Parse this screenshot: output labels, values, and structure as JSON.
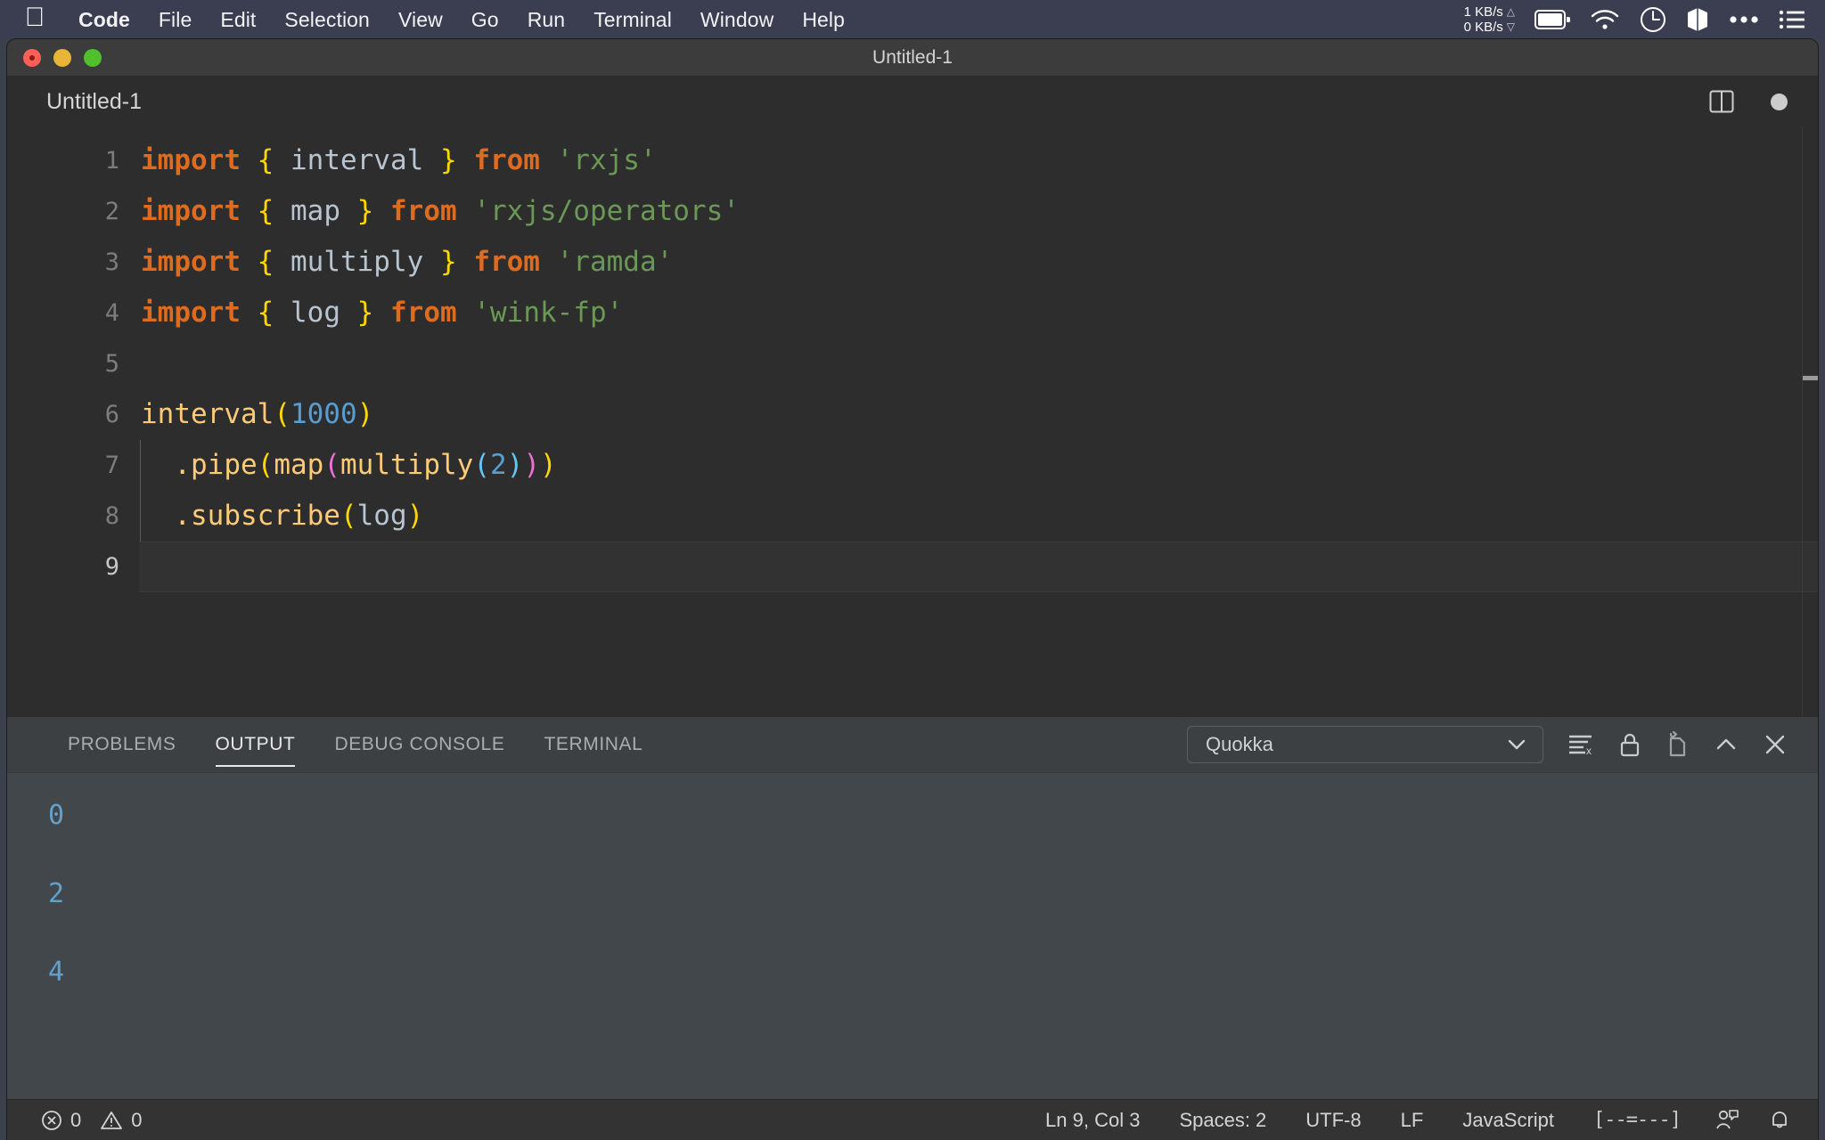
{
  "menubar": {
    "apple_icon": "apple-logo-icon",
    "items": [
      {
        "label": "Code",
        "bold": true
      },
      {
        "label": "File",
        "bold": false
      },
      {
        "label": "Edit",
        "bold": false
      },
      {
        "label": "Selection",
        "bold": false
      },
      {
        "label": "View",
        "bold": false
      },
      {
        "label": "Go",
        "bold": false
      },
      {
        "label": "Run",
        "bold": false
      },
      {
        "label": "Terminal",
        "bold": false
      },
      {
        "label": "Window",
        "bold": false
      },
      {
        "label": "Help",
        "bold": false
      }
    ],
    "network": {
      "upload": "1 KB/s",
      "download": "0 KB/s"
    },
    "status_icons": [
      "battery-icon",
      "wifi-icon",
      "clock-icon",
      "box-icon",
      "ellipsis-icon",
      "list-icon"
    ]
  },
  "window": {
    "title": "Untitled-1",
    "traffic_lights": [
      "close-button",
      "minimize-button",
      "maximize-button"
    ]
  },
  "editor": {
    "filename": "Untitled-1",
    "split_icon": "split-editor-icon",
    "dirty_indicator": "unsaved-changes-dot",
    "language": "JavaScript",
    "lines": [
      {
        "number": "1",
        "tokens": [
          {
            "t": "import",
            "c": "tk-keyword"
          },
          {
            "t": " ",
            "c": "tk-ident"
          },
          {
            "t": "{",
            "c": "tk-brace"
          },
          {
            "t": " interval ",
            "c": "tk-ident"
          },
          {
            "t": "}",
            "c": "tk-brace"
          },
          {
            "t": " ",
            "c": "tk-ident"
          },
          {
            "t": "from",
            "c": "tk-keyword"
          },
          {
            "t": " ",
            "c": "tk-ident"
          },
          {
            "t": "'rxjs'",
            "c": "tk-string"
          }
        ]
      },
      {
        "number": "2",
        "tokens": [
          {
            "t": "import",
            "c": "tk-keyword"
          },
          {
            "t": " ",
            "c": "tk-ident"
          },
          {
            "t": "{",
            "c": "tk-brace"
          },
          {
            "t": " map ",
            "c": "tk-ident"
          },
          {
            "t": "}",
            "c": "tk-brace"
          },
          {
            "t": " ",
            "c": "tk-ident"
          },
          {
            "t": "from",
            "c": "tk-keyword"
          },
          {
            "t": " ",
            "c": "tk-ident"
          },
          {
            "t": "'rxjs/operators'",
            "c": "tk-string"
          }
        ]
      },
      {
        "number": "3",
        "tokens": [
          {
            "t": "import",
            "c": "tk-keyword"
          },
          {
            "t": " ",
            "c": "tk-ident"
          },
          {
            "t": "{",
            "c": "tk-brace"
          },
          {
            "t": " multiply ",
            "c": "tk-ident"
          },
          {
            "t": "}",
            "c": "tk-brace"
          },
          {
            "t": " ",
            "c": "tk-ident"
          },
          {
            "t": "from",
            "c": "tk-keyword"
          },
          {
            "t": " ",
            "c": "tk-ident"
          },
          {
            "t": "'ramda'",
            "c": "tk-string"
          }
        ]
      },
      {
        "number": "4",
        "tokens": [
          {
            "t": "import",
            "c": "tk-keyword"
          },
          {
            "t": " ",
            "c": "tk-ident"
          },
          {
            "t": "{",
            "c": "tk-brace"
          },
          {
            "t": " log ",
            "c": "tk-ident"
          },
          {
            "t": "}",
            "c": "tk-brace"
          },
          {
            "t": " ",
            "c": "tk-ident"
          },
          {
            "t": "from",
            "c": "tk-keyword"
          },
          {
            "t": " ",
            "c": "tk-ident"
          },
          {
            "t": "'wink-fp'",
            "c": "tk-string"
          }
        ]
      },
      {
        "number": "5",
        "tokens": []
      },
      {
        "number": "6",
        "tokens": [
          {
            "t": "interval",
            "c": "tk-func"
          },
          {
            "t": "(",
            "c": "tk-paren1"
          },
          {
            "t": "1000",
            "c": "tk-num"
          },
          {
            "t": ")",
            "c": "tk-paren1"
          }
        ]
      },
      {
        "number": "7",
        "indent_guide": true,
        "tokens": [
          {
            "t": "  .pipe",
            "c": "tk-func"
          },
          {
            "t": "(",
            "c": "tk-paren1"
          },
          {
            "t": "map",
            "c": "tk-func"
          },
          {
            "t": "(",
            "c": "tk-paren2"
          },
          {
            "t": "multiply",
            "c": "tk-func"
          },
          {
            "t": "(",
            "c": "tk-paren3"
          },
          {
            "t": "2",
            "c": "tk-num"
          },
          {
            "t": ")",
            "c": "tk-paren3"
          },
          {
            "t": ")",
            "c": "tk-paren2"
          },
          {
            "t": ")",
            "c": "tk-paren1"
          }
        ]
      },
      {
        "number": "8",
        "indent_guide": true,
        "tokens": [
          {
            "t": "  .subscribe",
            "c": "tk-func"
          },
          {
            "t": "(",
            "c": "tk-paren1"
          },
          {
            "t": "log",
            "c": "tk-ident"
          },
          {
            "t": ")",
            "c": "tk-paren1"
          }
        ]
      },
      {
        "number": "9",
        "tokens": [],
        "current": true
      }
    ]
  },
  "panel": {
    "tabs": [
      {
        "label": "PROBLEMS",
        "active": false
      },
      {
        "label": "OUTPUT",
        "active": true
      },
      {
        "label": "DEBUG CONSOLE",
        "active": false
      },
      {
        "label": "TERMINAL",
        "active": false
      }
    ],
    "channel_select": {
      "value": "Quokka",
      "chevron": "chevron-down-icon"
    },
    "actions": [
      "clear-output-icon",
      "lock-scroll-icon",
      "open-in-editor-icon",
      "maximize-panel-icon",
      "close-panel-icon"
    ],
    "output_lines": [
      "0",
      "2",
      "4"
    ]
  },
  "statusbar": {
    "errors": {
      "icon": "error-icon",
      "count": "0"
    },
    "warnings": {
      "icon": "warning-icon",
      "count": "0"
    },
    "cursor_position": "Ln 9, Col 3",
    "indentation": "Spaces: 2",
    "encoding": "UTF-8",
    "eol": "LF",
    "language_mode": "JavaScript",
    "layout_indicator": "[--=---]",
    "right_icons": [
      "feedback-icon",
      "notifications-bell-icon"
    ]
  },
  "colors": {
    "menubar_bg": "#3b3e50",
    "editor_bg": "#2d2d2d",
    "panel_bg": "#3c4043",
    "panel_body_bg": "#42474b",
    "statusbar_bg": "#333333",
    "keyword": "#dd6b20",
    "string": "#6a9955",
    "function": "#fdca78",
    "number": "#589ed0",
    "bracket_l1": "#ffd700",
    "bracket_l2": "#ef6fd6",
    "bracket_l3": "#63c5f5",
    "output_text": "#64a0cb"
  }
}
